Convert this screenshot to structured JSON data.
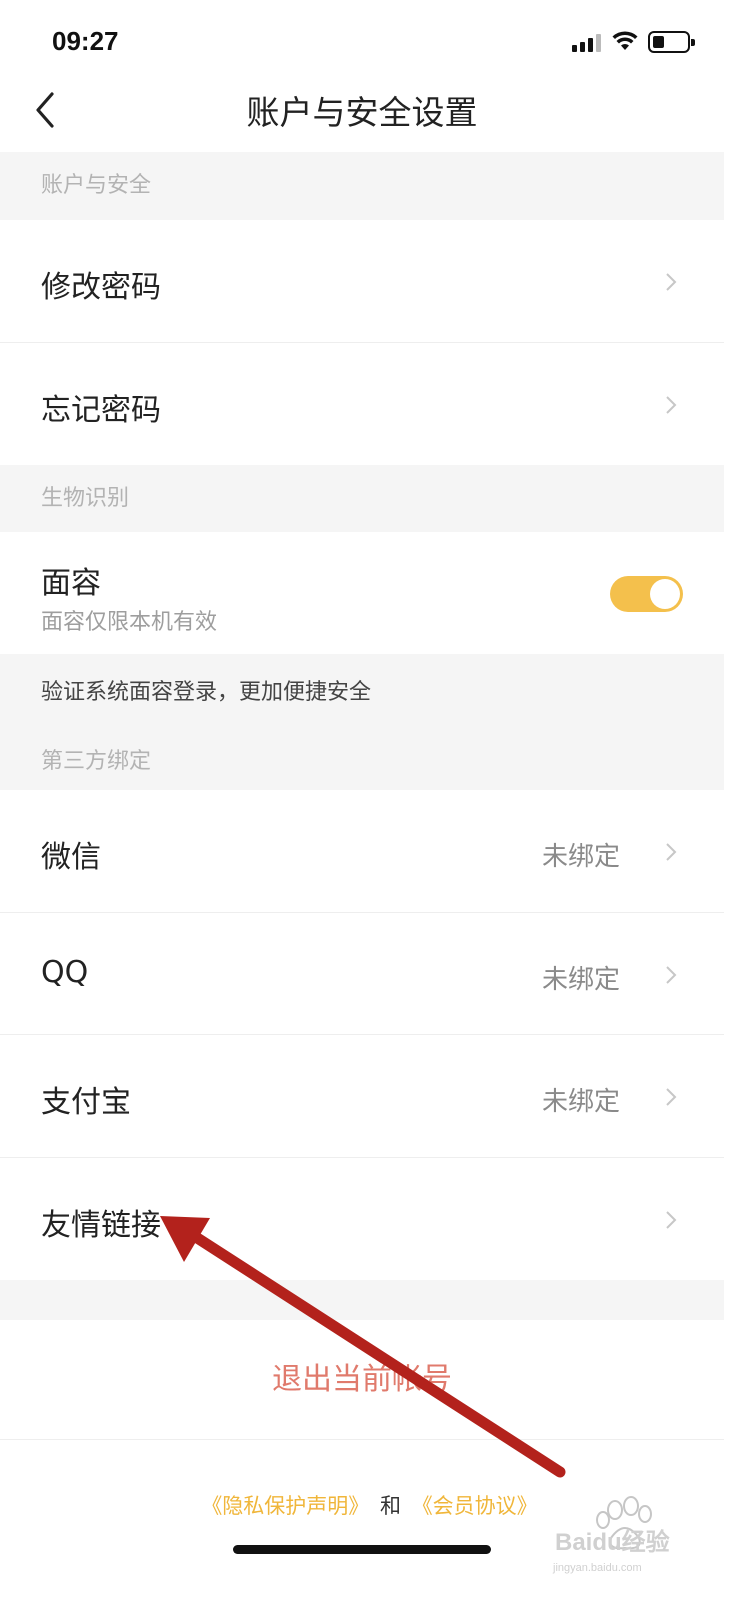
{
  "status_bar": {
    "time": "09:27"
  },
  "nav": {
    "title": "账户与安全设置"
  },
  "sections": {
    "account": {
      "header": "账户与安全"
    },
    "biometric": {
      "header": "生物识别"
    },
    "third_party": {
      "header": "第三方绑定"
    }
  },
  "rows": {
    "change_password": {
      "label": "修改密码"
    },
    "forgot_password": {
      "label": "忘记密码"
    },
    "face_id": {
      "label": "面容",
      "sublabel": "面容仅限本机有效",
      "enabled": true
    },
    "face_note": "验证系统面容登录，更加便捷安全",
    "wechat": {
      "label": "微信",
      "status": "未绑定"
    },
    "qq": {
      "label": "QQ",
      "status": "未绑定"
    },
    "alipay": {
      "label": "支付宝",
      "status": "未绑定"
    },
    "friend_links": {
      "label": "友情链接"
    }
  },
  "logout": {
    "label": "退出当前帐号"
  },
  "footer": {
    "privacy_link": "《隐私保护声明》",
    "conjunction": "和",
    "member_link": "《会员协议》"
  },
  "watermark": {
    "text": "Baidu经验",
    "sub": "jingyan.baidu.com"
  },
  "colors": {
    "accent": "#f4c04c",
    "logout": "#e07a6c",
    "link": "#f0b63a",
    "section_bg": "#f5f5f5",
    "arrow": "#b3221c"
  },
  "icons": [
    "back-chevron-icon",
    "signal-icon",
    "wifi-icon",
    "battery-icon",
    "chevron-right-icon"
  ]
}
